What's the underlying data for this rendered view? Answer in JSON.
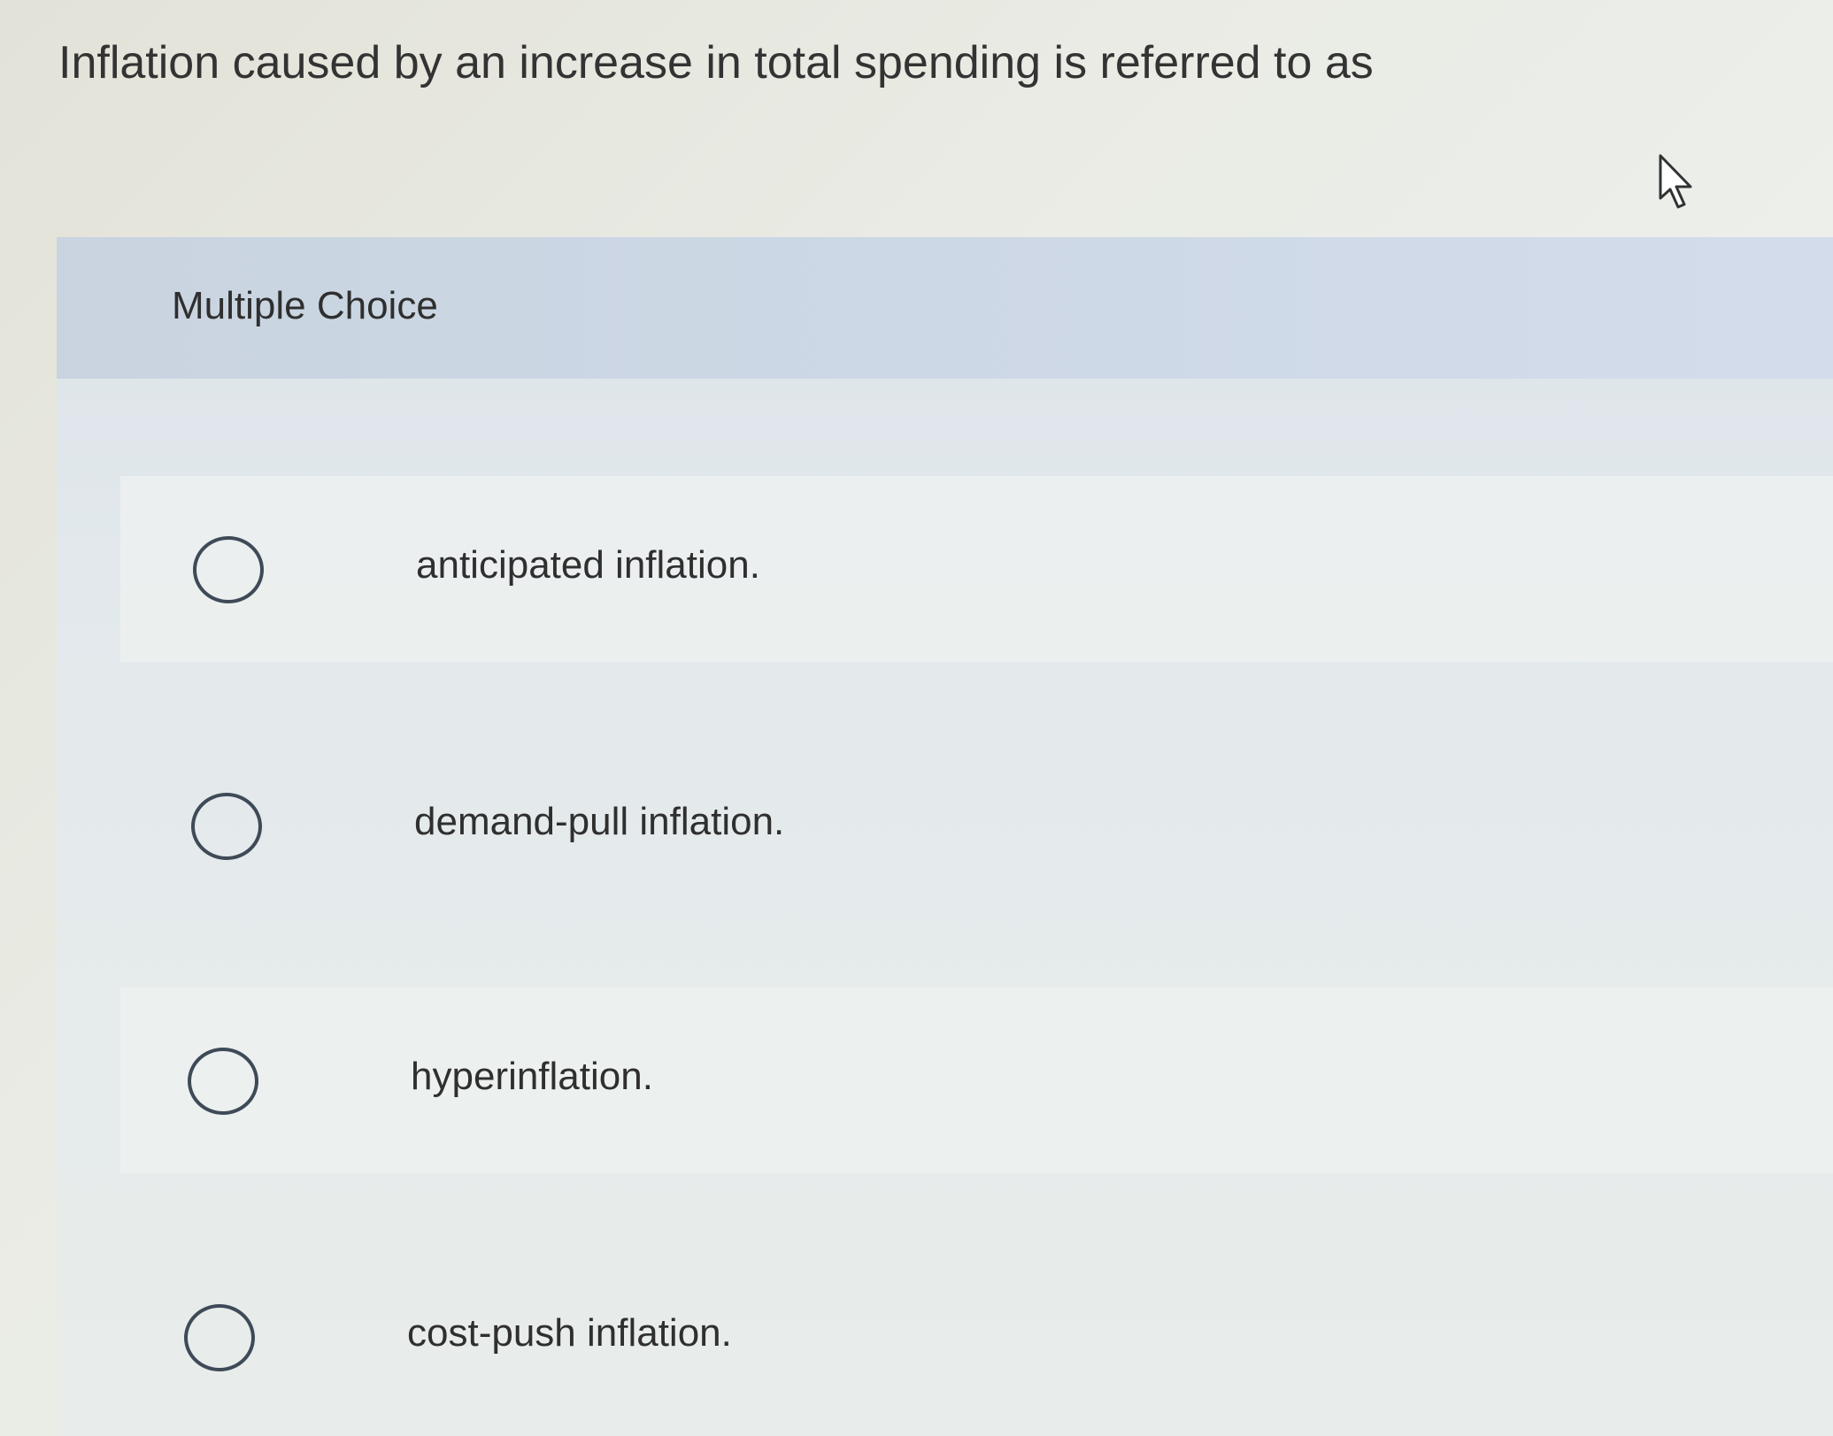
{
  "question": {
    "text": "Inflation caused by an increase in total spending is referred to as"
  },
  "multiple_choice": {
    "header_label": "Multiple Choice",
    "options": [
      {
        "label": "anticipated inflation."
      },
      {
        "label": "demand-pull inflation."
      },
      {
        "label": "hyperinflation."
      },
      {
        "label": "cost-push inflation."
      }
    ]
  },
  "colors": {
    "header_band": "#cdd8e6",
    "radio_border": "#3f4a58",
    "text": "#2f2f2f"
  },
  "icons": {
    "cursor": "mouse-pointer-icon",
    "radio": "radio-circle-icon"
  }
}
